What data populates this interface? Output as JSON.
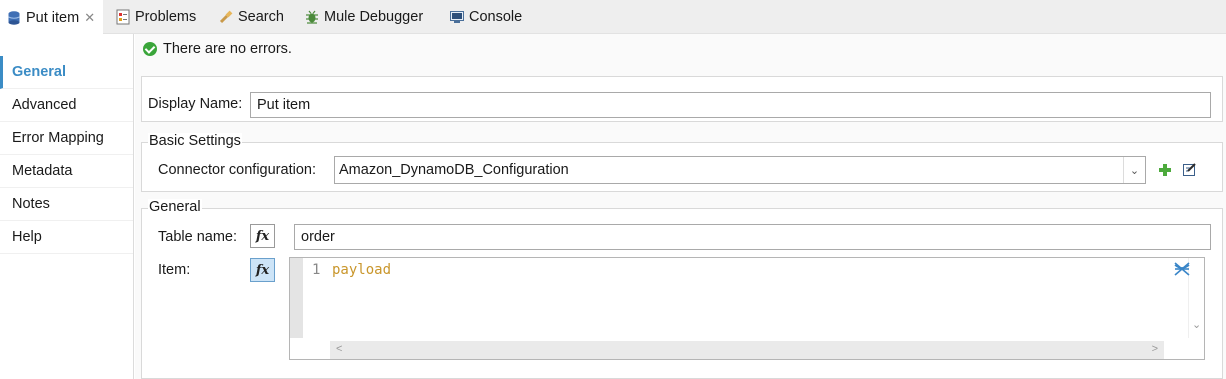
{
  "tabs": [
    {
      "label": "Put item",
      "icon": "database-icon",
      "active": true
    },
    {
      "label": "Problems",
      "icon": "problems-icon"
    },
    {
      "label": "Search",
      "icon": "search-flashlight-icon"
    },
    {
      "label": "Mule Debugger",
      "icon": "bug-icon"
    },
    {
      "label": "Console",
      "icon": "console-icon"
    }
  ],
  "nav": [
    "General",
    "Advanced",
    "Error Mapping",
    "Metadata",
    "Notes",
    "Help"
  ],
  "status": "There are no errors.",
  "display_name": {
    "label": "Display Name:",
    "value": "Put item"
  },
  "basic_settings": {
    "title": "Basic Settings",
    "connector_label": "Connector configuration:",
    "connector_value": "Amazon_DynamoDB_Configuration"
  },
  "general": {
    "title": "General",
    "table_label": "Table name:",
    "table_value": "order",
    "item_label": "Item:",
    "line_number": "1",
    "item_code": "payload",
    "fx_label": "fx"
  },
  "colors": {
    "accent": "#3b8cc5",
    "success": "#3aa53a",
    "code": "#c9962b",
    "add": "#4caa3c"
  }
}
